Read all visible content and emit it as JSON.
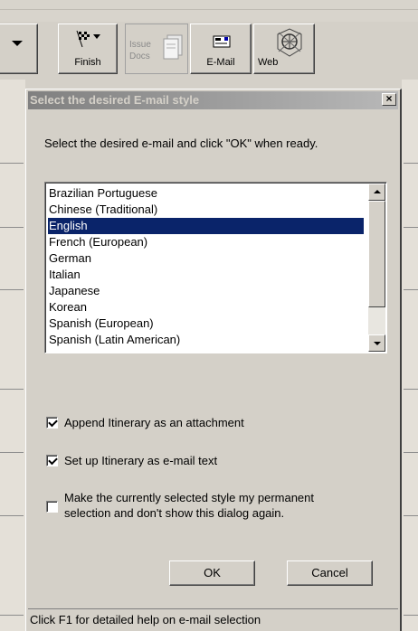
{
  "toolbar": {
    "finish_label": "Finish",
    "issue_docs_label": "Issue Docs",
    "email_label": "E-Mail",
    "web_label": "Web"
  },
  "dialog": {
    "title": "Select the desired E-mail style",
    "close_label": "×",
    "instructions": "Select the desired e-mail and click \"OK\" when ready.",
    "languages": [
      "Brazilian Portuguese",
      "Chinese (Traditional)",
      "English",
      "French (European)",
      "German",
      "Italian",
      "Japanese",
      "Korean",
      "Spanish (European)",
      "Spanish (Latin American)"
    ],
    "selected_language": "English",
    "options": {
      "append_itinerary": {
        "label": "Append Itinerary as an attachment",
        "checked": true
      },
      "setup_itinerary": {
        "label": "Set up Itinerary as e-mail text",
        "checked": true
      },
      "make_permanent": {
        "label_line1": "Make the currently selected style my permanent",
        "label_line2": "selection and don't show this dialog again.",
        "checked": false
      }
    },
    "ok_label": "OK",
    "cancel_label": "Cancel",
    "status_text": "Click F1 for detailed help on e-mail selection"
  },
  "colors": {
    "selection": "#0a246a",
    "dialog_face": "#d4d0c8"
  }
}
